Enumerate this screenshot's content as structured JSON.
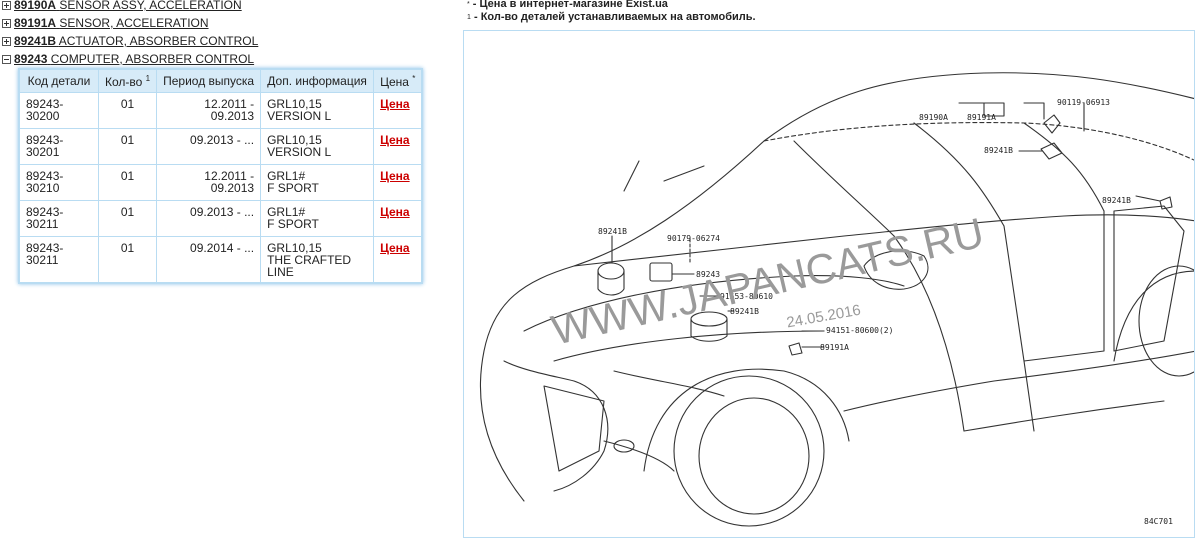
{
  "tree": [
    {
      "code": "89190A",
      "name": "SENSOR ASSY, ACCELERATION",
      "expanded": false
    },
    {
      "code": "89191A",
      "name": "SENSOR, ACCELERATION",
      "expanded": false
    },
    {
      "code": "89241B",
      "name": "ACTUATOR, ABSORBER CONTROL",
      "expanded": false
    },
    {
      "code": "89243",
      "name": "COMPUTER, ABSORBER CONTROL",
      "expanded": true
    }
  ],
  "table": {
    "headers": {
      "code": "Код детали",
      "qty": "Кол-во",
      "qty_sup": "1",
      "period": "Период выпуска",
      "info": "Доп. информация",
      "price": "Цена",
      "price_sup": "*"
    },
    "rows": [
      {
        "code": "89243-30200",
        "qty": "01",
        "period": "12.2011 - 09.2013",
        "info1": "GRL10,15",
        "info2": "VERSION L",
        "price": "Цена"
      },
      {
        "code": "89243-30201",
        "qty": "01",
        "period": "09.2013 - ...",
        "info1": "GRL10,15",
        "info2": "VERSION L",
        "price": "Цена"
      },
      {
        "code": "89243-30210",
        "qty": "01",
        "period": "12.2011 - 09.2013",
        "info1": "GRL1#",
        "info2": "F SPORT",
        "price": "Цена"
      },
      {
        "code": "89243-30211",
        "qty": "01",
        "period": "09.2013 - ...",
        "info1": "GRL1#",
        "info2": "F SPORT",
        "price": "Цена"
      },
      {
        "code": "89243-30211",
        "qty": "01",
        "period": "09.2014 - ...",
        "info1": "GRL10,15",
        "info2": "THE CRAFTED LINE",
        "price": "Цена"
      }
    ]
  },
  "notes": {
    "note1_mark": "*",
    "note1": "- Цена в интернет-магазине Exist.ua",
    "note2_mark": "1",
    "note2": "- Кол-во деталей устанавливаемых на автомобиль."
  },
  "diagram": {
    "watermark": "WWW.JAPANCATS.RU",
    "date": "24.05.2016",
    "figure_code": "84C701",
    "labels": {
      "l89190A": "89190A",
      "l89191A_top": "89191A",
      "l90119": "90119-06913",
      "l89241B_right_top": "89241B",
      "l89241B_right": "89241B",
      "l89241B_left": "89241B",
      "l90179": "90179-06274",
      "l89243": "89243",
      "l91553": "91553-80610",
      "l89241B_mid": "89241B",
      "l94151": "94151-80600(2)",
      "l89191A_bottom": "89191A"
    }
  }
}
